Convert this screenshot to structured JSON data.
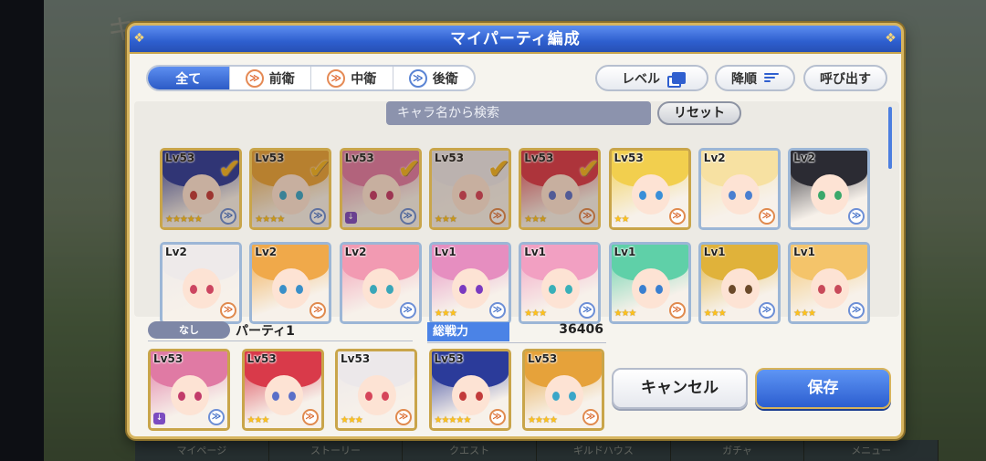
{
  "backdrop": {
    "title": "キ",
    "nav": [
      "マイページ",
      "ストーリー",
      "クエスト",
      "ギルドハウス",
      "ガチャ",
      "メニュー"
    ]
  },
  "dialog": {
    "title": "マイパーティ編成"
  },
  "filters": [
    {
      "label": "全て",
      "icon": "",
      "active": true
    },
    {
      "label": "前衛",
      "icon": "≫",
      "active": false
    },
    {
      "label": "中衛",
      "icon": "≫",
      "active": false
    },
    {
      "label": "後衛",
      "icon": "≫",
      "active": false
    }
  ],
  "toolbar": {
    "sort_label": "レベル",
    "order_label": "降順",
    "load_label": "呼び出す"
  },
  "search": {
    "placeholder": "キャラ名から検索",
    "reset_label": "リセット"
  },
  "characters": [
    {
      "lv": "Lv53",
      "stars": "★★★★★",
      "selected": true,
      "hair": "#2b3b9a",
      "eyes": "#c23b3b",
      "rank": "blue",
      "frame": "gold"
    },
    {
      "lv": "Lv53",
      "stars": "★★★★",
      "selected": true,
      "hair": "#e6a23a",
      "eyes": "#3aa6c8",
      "rank": "blue",
      "frame": "gold"
    },
    {
      "lv": "Lv53",
      "stars": "",
      "selected": true,
      "hair": "#e07aa4",
      "eyes": "#c23b6a",
      "rank": "blue",
      "frame": "gold",
      "purple": true
    },
    {
      "lv": "Lv53",
      "stars": "★★★",
      "selected": true,
      "hair": "#ece8ea",
      "eyes": "#d6455a",
      "rank": "orange",
      "frame": "gold"
    },
    {
      "lv": "Lv53",
      "stars": "★★★",
      "selected": true,
      "hair": "#d93a4a",
      "eyes": "#5a6fc8",
      "rank": "orange",
      "frame": "gold"
    },
    {
      "lv": "Lv53",
      "stars": "★★",
      "selected": false,
      "hair": "#f2cf4e",
      "eyes": "#3a8fd8",
      "rank": "orange",
      "frame": "gold"
    },
    {
      "lv": "Lv2",
      "stars": "",
      "selected": false,
      "hair": "#f7e1a2",
      "eyes": "#4a7fd0",
      "rank": "orange",
      "frame": "silver"
    },
    {
      "lv": "Lv2",
      "stars": "",
      "selected": false,
      "hair": "#2b2b33",
      "eyes": "#3ba86b",
      "rank": "blue",
      "frame": "silver"
    },
    {
      "lv": "Lv2",
      "stars": "",
      "selected": false,
      "hair": "#eeeaea",
      "eyes": "#cc4560",
      "rank": "orange",
      "frame": "silver"
    },
    {
      "lv": "Lv2",
      "stars": "",
      "selected": false,
      "hair": "#f0a94a",
      "eyes": "#3a8fc8",
      "rank": "orange",
      "frame": "silver"
    },
    {
      "lv": "Lv2",
      "stars": "",
      "selected": false,
      "hair": "#f29ab2",
      "eyes": "#3aa6b8",
      "rank": "blue",
      "frame": "silver"
    },
    {
      "lv": "Lv1",
      "stars": "★★★",
      "selected": false,
      "hair": "#e68ec0",
      "eyes": "#7a3ac0",
      "rank": "blue",
      "frame": "silver"
    },
    {
      "lv": "Lv1",
      "stars": "★★★",
      "selected": false,
      "hair": "#f2a0c2",
      "eyes": "#3ab0b8",
      "rank": "blue",
      "frame": "silver"
    },
    {
      "lv": "Lv1",
      "stars": "★★★",
      "selected": false,
      "hair": "#5fd0a8",
      "eyes": "#3a7fd0",
      "rank": "orange",
      "frame": "silver"
    },
    {
      "lv": "Lv1",
      "stars": "★★★",
      "selected": false,
      "hair": "#e0b23a",
      "eyes": "#6b4a2a",
      "rank": "blue",
      "frame": "silver"
    },
    {
      "lv": "Lv1",
      "stars": "★★★",
      "selected": false,
      "hair": "#f4c46a",
      "eyes": "#c84a5a",
      "rank": "blue",
      "frame": "silver"
    }
  ],
  "party": {
    "tag": "なし",
    "name": "パーティ1",
    "power_label": "総戦力",
    "power_value": "36406",
    "members": [
      {
        "lv": "Lv53",
        "stars": "",
        "hair": "#e07aa4",
        "eyes": "#c23b6a",
        "rank": "blue",
        "purple": true
      },
      {
        "lv": "Lv53",
        "stars": "★★★",
        "hair": "#d93a4a",
        "eyes": "#5a6fc8",
        "rank": "orange"
      },
      {
        "lv": "Lv53",
        "stars": "★★★",
        "hair": "#ece8ea",
        "eyes": "#d6455a",
        "rank": "orange"
      },
      {
        "lv": "Lv53",
        "stars": "★★★★★",
        "hair": "#2b3b9a",
        "eyes": "#c23b3b",
        "rank": "orange"
      },
      {
        "lv": "Lv53",
        "stars": "★★★★",
        "hair": "#e6a23a",
        "eyes": "#3aa6c8",
        "rank": "orange"
      }
    ]
  },
  "actions": {
    "cancel_label": "キャンセル",
    "save_label": "保存"
  }
}
